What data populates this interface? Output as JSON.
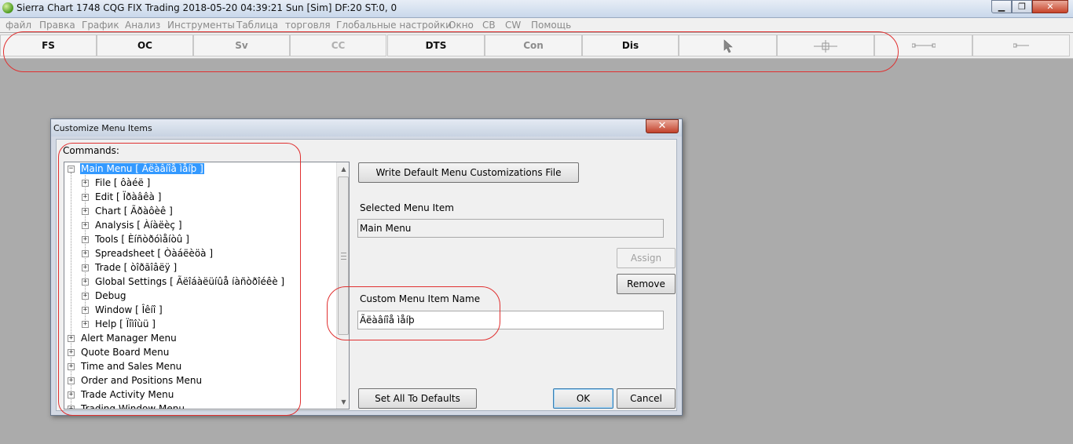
{
  "window": {
    "title": "Sierra Chart 1748 CQG FIX Trading 2018-05-20  04:39:21 Sun [Sim]  DF:20  ST:0, 0",
    "minimize_glyph": "▁",
    "maximize_glyph": "❐",
    "close_glyph": "✕"
  },
  "menubar": {
    "items": [
      "файл",
      "Правка",
      "График",
      "Анализ",
      "Инструменты",
      "Таблица",
      "торговля",
      "Глобальные настройки",
      "Окно",
      "CB",
      "CW",
      "Помощь"
    ]
  },
  "toolbar": {
    "buttons": [
      "FS",
      "OC",
      "Sv",
      "CC",
      "DTS",
      "Con",
      "Dis"
    ],
    "icons": [
      "pointer-icon",
      "crosshair-icon",
      "line-segment-icon",
      "ray-line-icon"
    ]
  },
  "dialog": {
    "title": "Customize Menu Items",
    "close_glyph": "✕",
    "commands_label": "Commands:",
    "tree": [
      {
        "label": "Main Menu [ Ãëàâíîå ìåíþ ]",
        "level": 0,
        "expander": "−",
        "selected": true
      },
      {
        "label": "File [ ôàéë ]",
        "level": 1,
        "expander": "+"
      },
      {
        "label": "Edit [ Ïðàâêà ]",
        "level": 1,
        "expander": "+"
      },
      {
        "label": "Chart [ Ãðàôèê ]",
        "level": 1,
        "expander": "+"
      },
      {
        "label": "Analysis [ Àíàëèç ]",
        "level": 1,
        "expander": "+"
      },
      {
        "label": "Tools [ Èíñòðóìåíòû ]",
        "level": 1,
        "expander": "+"
      },
      {
        "label": "Spreadsheet [ Òàáëèöà ]",
        "level": 1,
        "expander": "+"
      },
      {
        "label": "Trade [ òîðãîâëÿ ]",
        "level": 1,
        "expander": "+"
      },
      {
        "label": "Global Settings [ Ãëîáàëüíûå íàñòðîéêè ]",
        "level": 1,
        "expander": "+"
      },
      {
        "label": "Debug",
        "level": 1,
        "expander": "+"
      },
      {
        "label": "Window [ Îêíî ]",
        "level": 1,
        "expander": "+"
      },
      {
        "label": "Help [ Ïîìîùü ]",
        "level": 1,
        "expander": "+"
      },
      {
        "label": "Alert Manager Menu",
        "level": 0,
        "expander": "+"
      },
      {
        "label": "Quote Board Menu",
        "level": 0,
        "expander": "+"
      },
      {
        "label": "Time and Sales Menu",
        "level": 0,
        "expander": "+"
      },
      {
        "label": "Order and Positions Menu",
        "level": 0,
        "expander": "+"
      },
      {
        "label": "Trade Activity Menu",
        "level": 0,
        "expander": "+"
      },
      {
        "label": "Trading Window Menu",
        "level": 0,
        "expander": "+"
      }
    ],
    "write_default_button": "Write Default Menu Customizations File",
    "selected_item_label": "Selected Menu Item",
    "selected_item_value": "Main Menu",
    "assign_button": "Assign",
    "remove_button": "Remove",
    "custom_name_label": "Custom Menu Item Name",
    "custom_name_value": "Ãëàâíîå ìåíþ",
    "set_defaults_button": "Set All To Defaults",
    "ok_button": "OK",
    "cancel_button": "Cancel",
    "scroll_up_glyph": "▲",
    "scroll_down_glyph": "▼"
  },
  "colors": {
    "annotation_red": "#e03030",
    "selection_blue": "#3399ff",
    "desktop_gray": "#ababab"
  }
}
